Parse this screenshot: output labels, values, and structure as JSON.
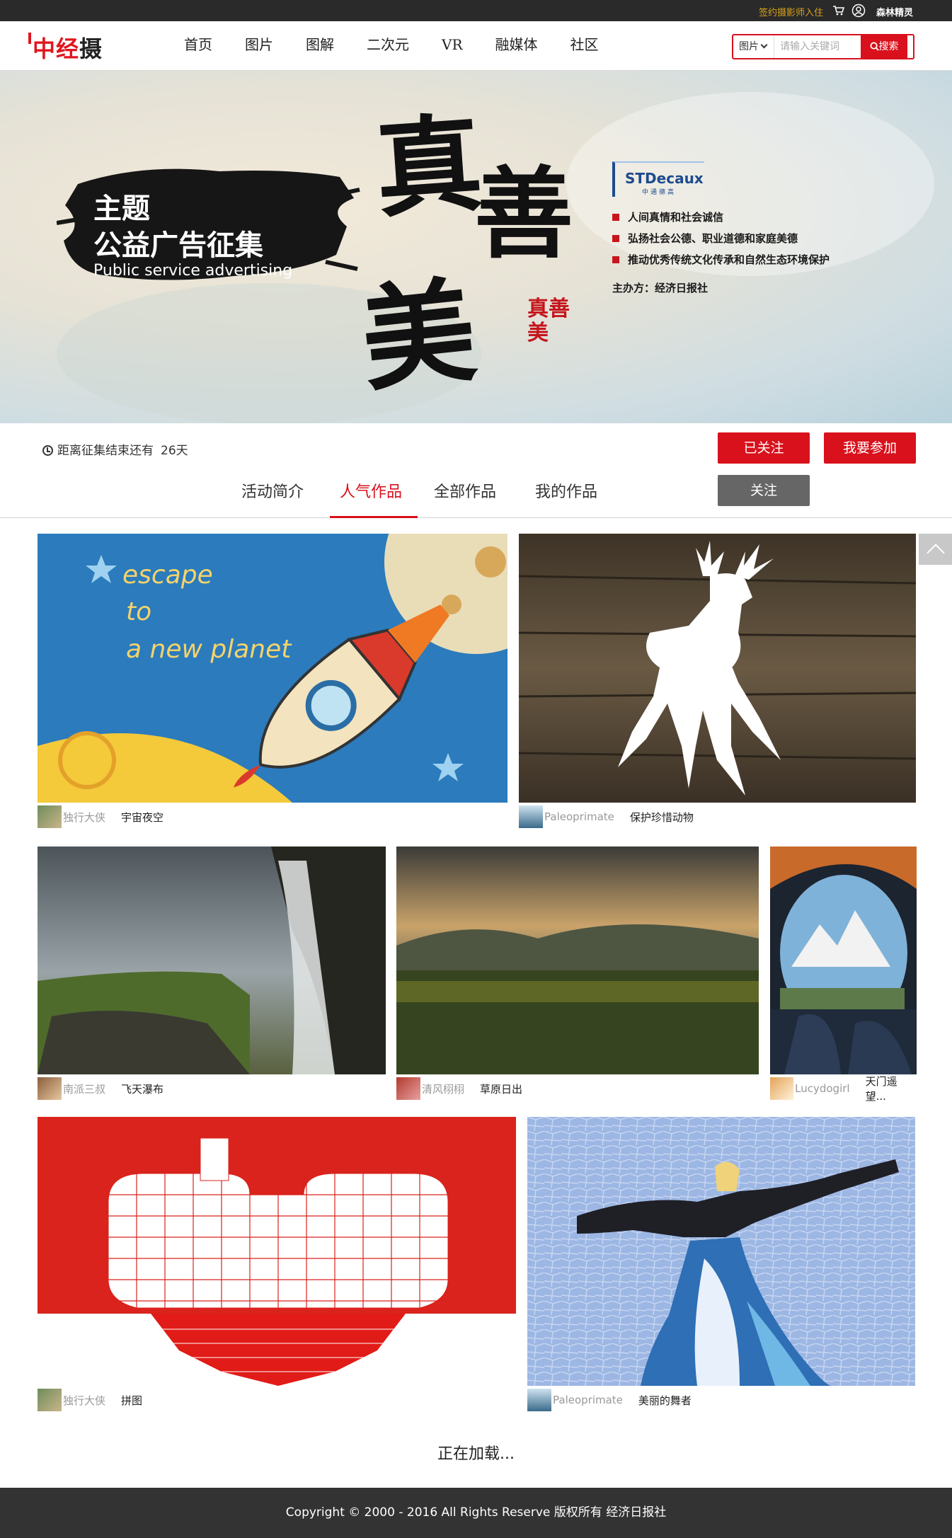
{
  "topbar": {
    "sign_link": "签约摄影师入住",
    "username": "森林精灵"
  },
  "header": {
    "logo_red": "中经",
    "logo_dark": "摄",
    "nav": [
      "首页",
      "图片",
      "图解",
      "二次元",
      "VR",
      "融媒体",
      "社区"
    ],
    "search": {
      "category": "图片",
      "placeholder": "请输入关键词",
      "button": "搜索"
    }
  },
  "banner": {
    "brush_line1": "主题",
    "brush_line2": "公益广告征集",
    "brush_line3": "Public service advertising",
    "calligraphy": [
      "真",
      "善",
      "美"
    ],
    "seal": "真善美",
    "sponsor_name": "STDecaux",
    "sponsor_sub": "中通德高",
    "points": [
      "人间真情和社会诚信",
      "弘扬社会公德、职业道德和家庭美德",
      "推动优秀传统文化传承和自然生态环境保护"
    ],
    "host": "主办方：经济日报社"
  },
  "activity": {
    "countdown_label": "距离征集结束还有",
    "countdown_days": "26天",
    "followed_button": "已关注",
    "join_button": "我要参加",
    "follow_button": "关注"
  },
  "tabs": [
    "活动简介",
    "人气作品",
    "全部作品",
    "我的作品"
  ],
  "active_tab": "人气作品",
  "works": [
    {
      "author": "独行大侠",
      "title": "宇宙夜空",
      "theme": "rocket"
    },
    {
      "author": "Paleoprimate",
      "title": "保护珍惜动物",
      "theme": "deer"
    },
    {
      "author": "南派三叔",
      "title": "飞天瀑布",
      "theme": "waterfall"
    },
    {
      "author": "清风栩栩",
      "title": "草原日出",
      "theme": "meadow"
    },
    {
      "author": "Lucydogirl",
      "title": "天门遥望...",
      "theme": "tent"
    },
    {
      "author": "独行大侠",
      "title": "拼图",
      "theme": "heart"
    },
    {
      "author": "Paleoprimate",
      "title": "美丽的舞者",
      "theme": "dancer"
    }
  ],
  "artwork_text": {
    "rocket_line1": "escape",
    "rocket_line2": "to",
    "rocket_line3": "a new planet"
  },
  "loading_text": "正在加载...",
  "footer_text": "Copyright © 2000 - 2016    All Rights Reserve  版权所有 经济日报社",
  "colors": {
    "brand_red": "#d8111c",
    "topbar_bg": "#2a2a2a",
    "footer_bg": "#333333",
    "gold": "#d9a21b"
  }
}
